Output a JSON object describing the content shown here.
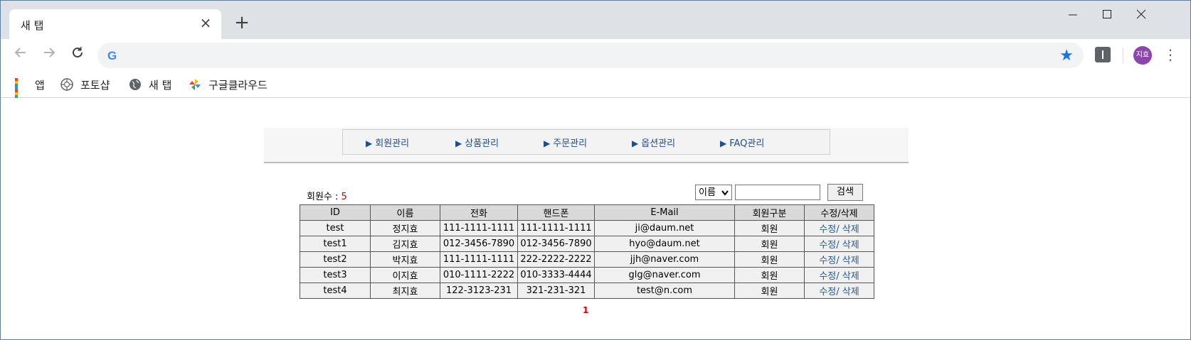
{
  "browser": {
    "tab_title": "새 탭",
    "tab_close": "×",
    "new_tab": "+",
    "avatar_text": "지효",
    "google_letter": "G"
  },
  "bookmarks": [
    {
      "label": "앱",
      "icon": "apps-grid-icon"
    },
    {
      "label": "포토샵",
      "icon": "aperture-icon"
    },
    {
      "label": "새 탭",
      "icon": "globe-icon"
    },
    {
      "label": "구글클라우드",
      "icon": "pinwheel-icon"
    }
  ],
  "menu": [
    "회원관리",
    "상품관리",
    "주문관리",
    "옵션관리",
    "FAQ관리"
  ],
  "summary": {
    "label": "회원수 : ",
    "count": "5"
  },
  "search": {
    "select_value": "이름",
    "input_value": "",
    "button_label": "검색"
  },
  "table": {
    "headers": [
      "ID",
      "이름",
      "전화",
      "핸드폰",
      "E-Mail",
      "회원구분",
      "수정/삭제"
    ],
    "rows": [
      {
        "id": "test",
        "name": "정지효",
        "phone": "111-1111-1111",
        "mobile": "111-1111-1111",
        "email": "ji@daum.net",
        "type": "회원",
        "edit": "수정/",
        "del": " 삭제"
      },
      {
        "id": "test1",
        "name": "김지효",
        "phone": "012-3456-7890",
        "mobile": "012-3456-7890",
        "email": "hyo@daum.net",
        "type": "회원",
        "edit": "수정/",
        "del": " 삭제"
      },
      {
        "id": "test2",
        "name": "박지효",
        "phone": "111-1111-1111",
        "mobile": "222-2222-2222",
        "email": "jjh@naver.com",
        "type": "회원",
        "edit": "수정/",
        "del": " 삭제"
      },
      {
        "id": "test3",
        "name": "이지효",
        "phone": "010-1111-2222",
        "mobile": "010-3333-4444",
        "email": "glg@naver.com",
        "type": "회원",
        "edit": "수정/",
        "del": " 삭제"
      },
      {
        "id": "test4",
        "name": "최지효",
        "phone": "122-3123-231",
        "mobile": "321-231-321",
        "email": "test@n.com",
        "type": "회원",
        "edit": "수정/",
        "del": " 삭제"
      }
    ]
  },
  "pagination": {
    "current": "1"
  },
  "colors": {
    "link": "#1f5a99",
    "accent_red": "#cc0000",
    "star_blue": "#1a73e8",
    "avatar": "#8e44ad"
  }
}
